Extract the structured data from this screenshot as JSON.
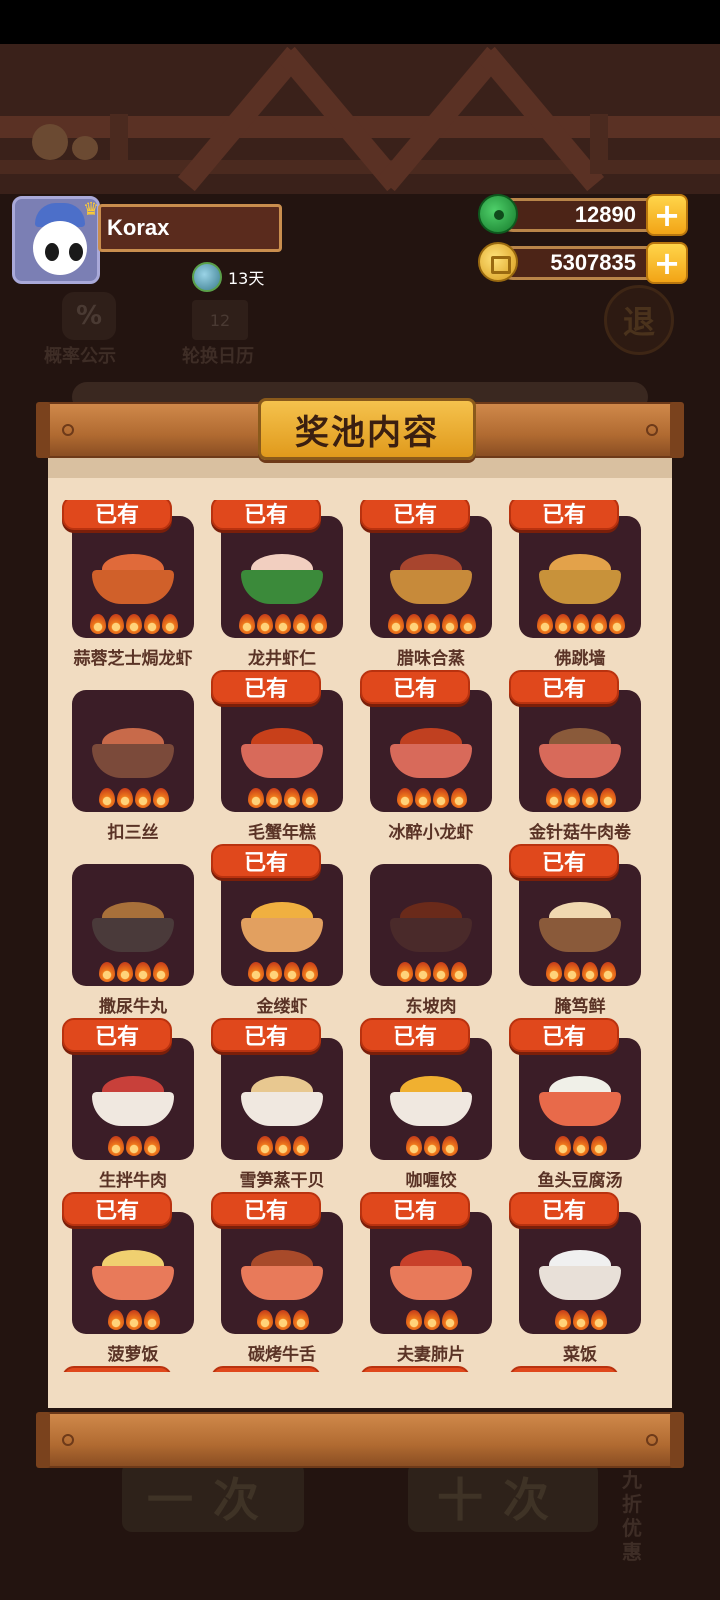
{
  "player": {
    "name": "Korax",
    "days": "13天"
  },
  "currency": {
    "jade": "12890",
    "coins": "5307835",
    "plus": "+"
  },
  "background": {
    "probability": "概率公示",
    "calendar": "轮换日历",
    "exit": "退",
    "pct_symbol": "%",
    "cal_num": "12",
    "draw_one": "一次",
    "draw_ten": "十次",
    "discount": "九折优惠"
  },
  "panel": {
    "title": "奖池内容",
    "owned_label": "已有"
  },
  "dishes": [
    {
      "name": "蒜蓉芝士焗龙虾",
      "owned": true,
      "flames": 5,
      "bowl": "#d0602a",
      "food": "#e06a3a"
    },
    {
      "name": "龙井虾仁",
      "owned": true,
      "flames": 5,
      "bowl": "#3b8a3a",
      "food": "#f2cfc0"
    },
    {
      "name": "腊味合蒸",
      "owned": true,
      "flames": 5,
      "bowl": "#c78a3a",
      "food": "#a8452e"
    },
    {
      "name": "佛跳墙",
      "owned": true,
      "flames": 5,
      "bowl": "#c8923a",
      "food": "#e3a24a"
    },
    {
      "name": "扣三丝",
      "owned": false,
      "flames": 4,
      "bowl": "#7b4a3a",
      "food": "#c86a4a"
    },
    {
      "name": "毛蟹年糕",
      "owned": true,
      "flames": 4,
      "bowl": "#d86a5a",
      "food": "#c8401a"
    },
    {
      "name": "冰醉小龙虾",
      "owned": true,
      "flames": 4,
      "bowl": "#d86a5a",
      "food": "#c04020"
    },
    {
      "name": "金针菇牛肉卷",
      "owned": true,
      "flames": 4,
      "bowl": "#d86a5a",
      "food": "#8a5a3a"
    },
    {
      "name": "撒尿牛丸",
      "owned": false,
      "flames": 4,
      "bowl": "#4a3a3a",
      "food": "#a8703a"
    },
    {
      "name": "金缕虾",
      "owned": true,
      "flames": 4,
      "bowl": "#e2a060",
      "food": "#f0b040"
    },
    {
      "name": "东坡肉",
      "owned": false,
      "flames": 4,
      "bowl": "#4a2a2a",
      "food": "#6a2a1a"
    },
    {
      "name": "腌笃鲜",
      "owned": true,
      "flames": 4,
      "bowl": "#8a5a3a",
      "food": "#f0d8b0"
    },
    {
      "name": "生拌牛肉",
      "owned": true,
      "flames": 3,
      "bowl": "#f0e8e0",
      "food": "#c8403a"
    },
    {
      "name": "雪笋蒸干贝",
      "owned": true,
      "flames": 3,
      "bowl": "#f0e8e0",
      "food": "#e8c890"
    },
    {
      "name": "咖喱饺",
      "owned": true,
      "flames": 3,
      "bowl": "#f0e8e0",
      "food": "#f0b030"
    },
    {
      "name": "鱼头豆腐汤",
      "owned": true,
      "flames": 3,
      "bowl": "#e86a4a",
      "food": "#f0f0e8"
    },
    {
      "name": "菠萝饭",
      "owned": true,
      "flames": 3,
      "bowl": "#e87a5a",
      "food": "#f0d070"
    },
    {
      "name": "碳烤牛舌",
      "owned": true,
      "flames": 3,
      "bowl": "#e87a5a",
      "food": "#a84a2a"
    },
    {
      "name": "夫妻肺片",
      "owned": true,
      "flames": 3,
      "bowl": "#e87a5a",
      "food": "#c8402a"
    },
    {
      "name": "菜饭",
      "owned": true,
      "flames": 3,
      "bowl": "#e8e0d8",
      "food": "#f0f0f0"
    },
    {
      "name": "",
      "owned": true,
      "flames": 0,
      "bowl": "#e87a5a",
      "food": "#e87a5a"
    },
    {
      "name": "",
      "owned": true,
      "flames": 0,
      "bowl": "#e87a5a",
      "food": "#e87a5a"
    },
    {
      "name": "",
      "owned": true,
      "flames": 0,
      "bowl": "#e87a5a",
      "food": "#e87a5a"
    },
    {
      "name": "",
      "owned": true,
      "flames": 0,
      "bowl": "#e87a5a",
      "food": "#e87a5a"
    }
  ]
}
